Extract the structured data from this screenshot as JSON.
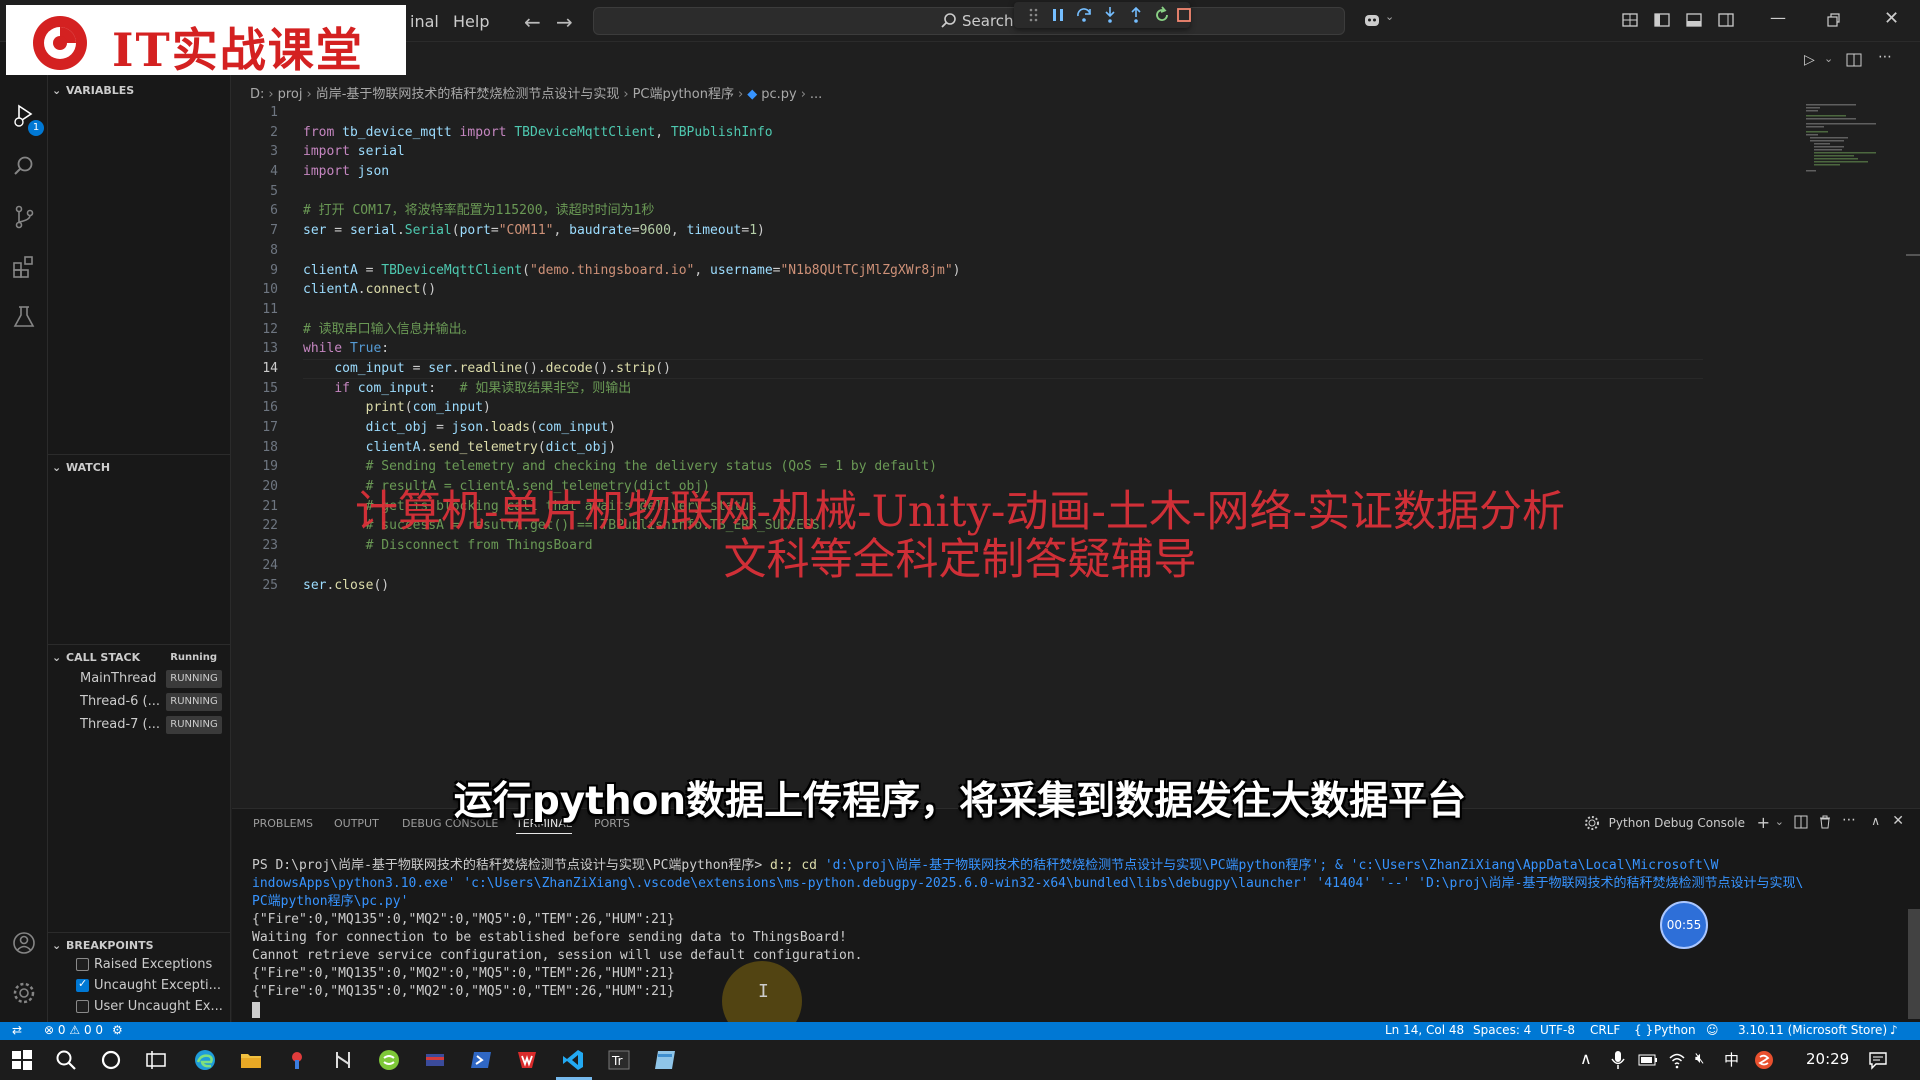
{
  "logo": {
    "text": "IT实战课堂"
  },
  "menu": {
    "items": [
      "inal",
      "Help"
    ]
  },
  "command_center": {
    "search_label": "Search"
  },
  "activity": {
    "run_badge": "1"
  },
  "sidebar": {
    "variables_title": "VARIABLES",
    "watch_title": "WATCH",
    "callstack_title": "CALL STACK",
    "callstack_status": "Running",
    "threads": [
      {
        "name": "MainThread",
        "status": "RUNNING"
      },
      {
        "name": "Thread-6 (...",
        "status": "RUNNING"
      },
      {
        "name": "Thread-7 (...",
        "status": "RUNNING"
      }
    ],
    "breakpoints_title": "BREAKPOINTS",
    "breakpoints": [
      {
        "label": "Raised Exceptions",
        "checked": false
      },
      {
        "label": "Uncaught Excepti...",
        "checked": true
      },
      {
        "label": "User Uncaught Ex...",
        "checked": false
      }
    ]
  },
  "breadcrumb": [
    "D:",
    "proj",
    "尚岸-基于物联网技术的秸秆焚烧检测节点设计与实现",
    "PC端python程序",
    "pc.py",
    "..."
  ],
  "editor": {
    "active_line": 14,
    "line_numbers": [
      "1",
      "2",
      "3",
      "4",
      "5",
      "6",
      "7",
      "8",
      "9",
      "10",
      "11",
      "12",
      "13",
      "14",
      "15",
      "16",
      "17",
      "18",
      "19",
      "20",
      "21",
      "22",
      "23",
      "24",
      "25"
    ],
    "code": [
      "",
      "from tb_device_mqtt import TBDeviceMqttClient, TBPublishInfo",
      "import serial",
      "import json",
      "",
      "# 打开 COM17，将波特率配置为115200，读超时时间为1秒",
      "ser = serial.Serial(port=\"COM11\", baudrate=9600, timeout=1)",
      "",
      "clientA = TBDeviceMqttClient(\"demo.thingsboard.io\", username=\"N1b8QUtTCjMlZgXWr8jm\")",
      "clientA.connect()",
      "",
      "# 读取串口输入信息并输出。",
      "while True:",
      "    com_input = ser.readline().decode().strip()",
      "    if com_input:   # 如果读取结果非空，则输出",
      "        print(com_input)",
      "        dict_obj = json.loads(com_input)",
      "        clientA.send_telemetry(dict_obj)",
      "        # Sending telemetry and checking the delivery status (QoS = 1 by default)",
      "        # resultA = clientA.send_telemetry(dict_obj)",
      "        # get is blocking call that awaits delivery status",
      "        # successA = resultA.get() == TBPublishInfo.TB_ERR_SUCCESS",
      "        # Disconnect from ThingsBoard",
      "",
      "ser.close()"
    ]
  },
  "overlay": {
    "ad_line1": "计算机-单片机物联网-机械-Unity-动画-土木-网络-实证数据分析",
    "ad_line2": "文科等全科定制答疑辅导",
    "subtitle": "运行python数据上传程序，将采集到数据发往大数据平台"
  },
  "panel": {
    "tabs": [
      "PROBLEMS",
      "OUTPUT",
      "DEBUG CONSOLE",
      "TERMINAL",
      "PORTS"
    ],
    "active_tab": "TERMINAL",
    "terminal_name": "Python Debug Console",
    "timer": "00:55",
    "terminal": {
      "prompt": "PS D:\\proj\\尚岸-基于物联网技术的秸秆焚烧检测节点设计与实现\\PC端python程序> ",
      "cmd": "d:; cd ",
      "cmd_line1_rest": "'d:\\proj\\尚岸-基于物联网技术的秸秆焚烧检测节点设计与实现\\PC端python程序'; & 'c:\\Users\\ZhanZiXiang\\AppData\\Local\\Microsoft\\W",
      "cmd_line2": "indowsApps\\python3.10.exe' 'c:\\Users\\ZhanZiXiang\\.vscode\\extensions\\ms-python.debugpy-2025.6.0-win32-x64\\bundled\\libs\\debugpy\\launcher' '41404' '--' 'D:\\proj\\尚岸-基于物联网技术的秸秆焚烧检测节点设计与实现\\",
      "cmd_line3": "PC端python程序\\pc.py'",
      "output": [
        "{\"Fire\":0,\"MQ135\":0,\"MQ2\":0,\"MQ5\":0,\"TEM\":26,\"HUM\":21}",
        "Waiting for connection to be established before sending data to ThingsBoard!",
        "Cannot retrieve service configuration, session will use default configuration.",
        "{\"Fire\":0,\"MQ135\":0,\"MQ2\":0,\"MQ5\":0,\"TEM\":26,\"HUM\":21}",
        "{\"Fire\":0,\"MQ135\":0,\"MQ2\":0,\"MQ5\":0,\"TEM\":26,\"HUM\":21}"
      ]
    }
  },
  "statusbar": {
    "errors": "0",
    "warnings": "0",
    "info": "0",
    "position": "Ln 14, Col 48",
    "spaces": "Spaces: 4",
    "encoding": "UTF-8",
    "eol": "CRLF",
    "language": "Python",
    "interpreter": "3.10.11 (Microsoft Store)"
  },
  "taskbar": {
    "ime": "中",
    "time": "20:29"
  },
  "colors": {
    "accent": "#0078d4",
    "logo_red": "#d42121",
    "overlay_red": "#e0313a"
  }
}
